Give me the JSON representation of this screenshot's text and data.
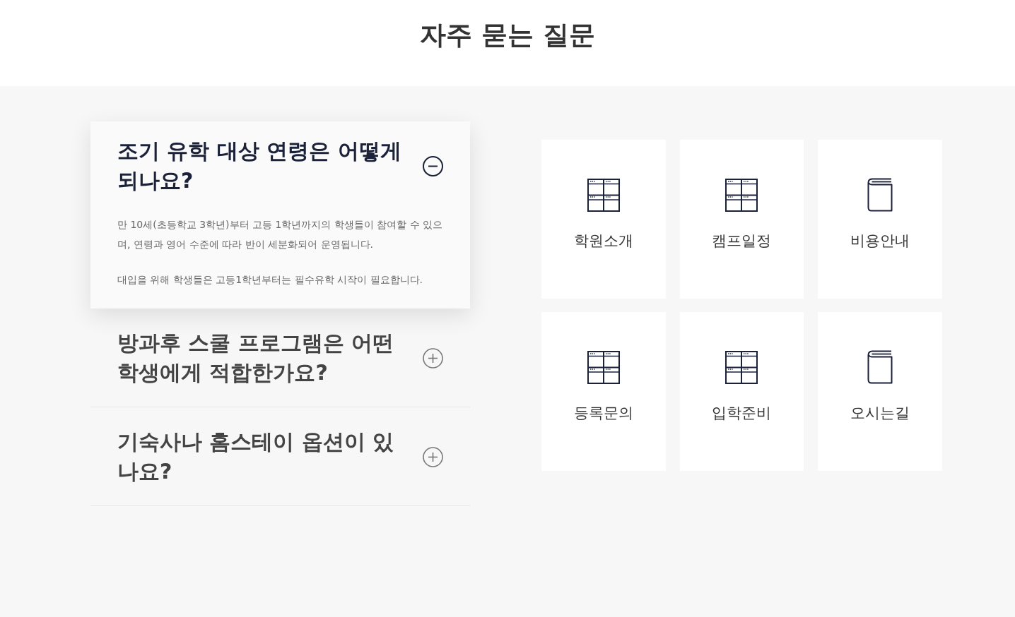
{
  "page": {
    "title": "자주 묻는 질문"
  },
  "faq": [
    {
      "question": "조기 유학 대상 연령은 어떻게 되나요?",
      "expanded": true,
      "answer": [
        "만 10세(초등학교 3학년)부터 고등 1학년까지의 학생들이 참여할 수 있으며, 연령과 영어 수준에 따라 반이 세분화되어 운영됩니다.",
        "대입을 위해 학생들은 고등1학년부터는 필수유학 시작이 필요합니다."
      ]
    },
    {
      "question": "방과후 스쿨 프로그램은 어떤 학생에게 적합한가요?",
      "expanded": false
    },
    {
      "question": "기숙사나 홈스테이 옵션이 있나요?",
      "expanded": false
    }
  ],
  "menu_tiles": [
    {
      "label": "학원소개",
      "kind": "grid"
    },
    {
      "label": "캠프일정",
      "kind": "grid"
    },
    {
      "label": "비용안내",
      "kind": "book"
    },
    {
      "label": "등록문의",
      "kind": "grid"
    },
    {
      "label": "입학준비",
      "kind": "grid"
    },
    {
      "label": "오시는길",
      "kind": "book"
    }
  ]
}
